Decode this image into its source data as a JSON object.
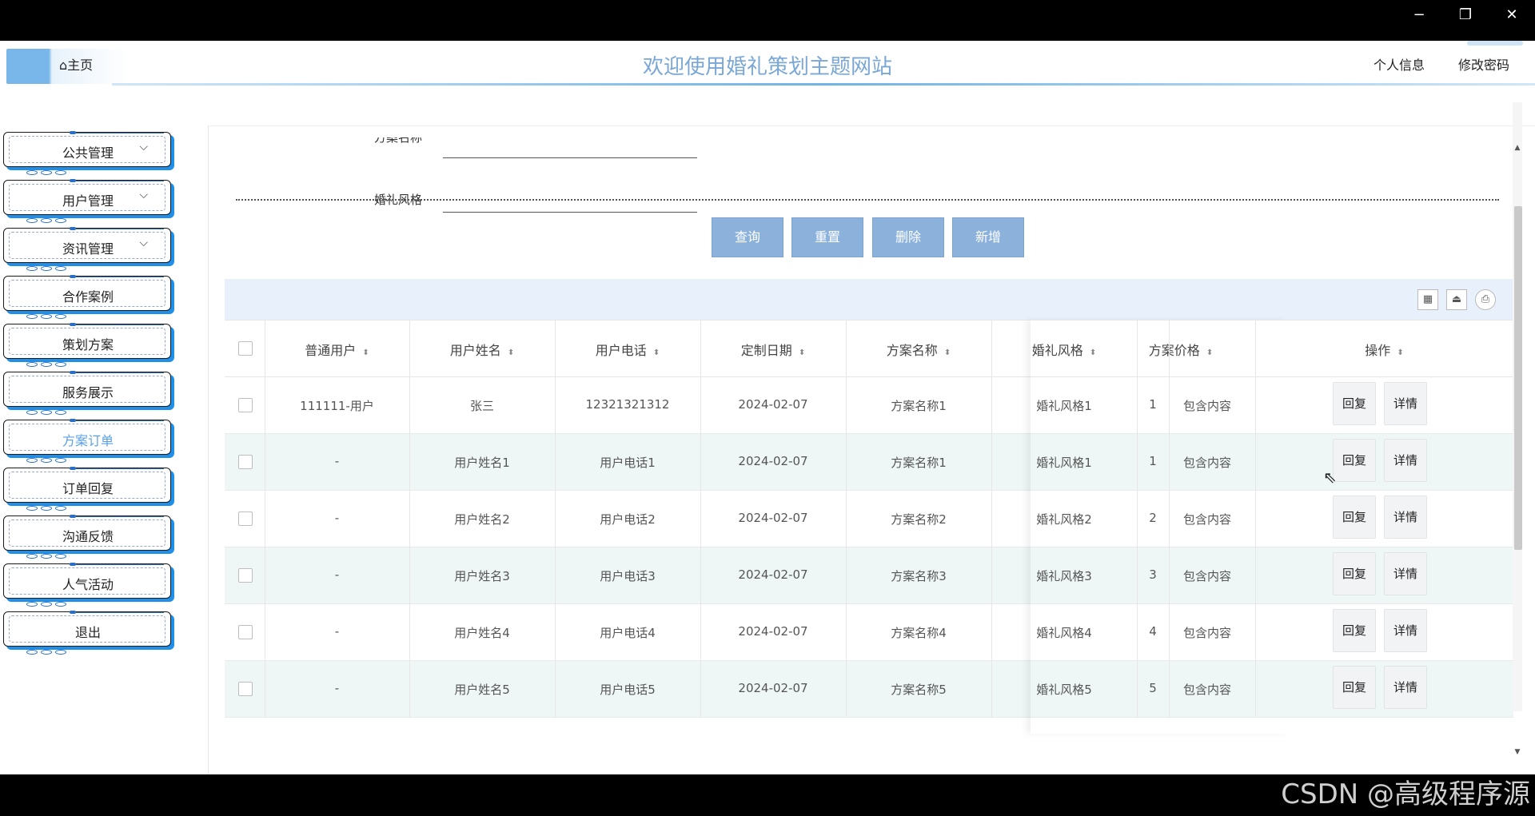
{
  "window": {
    "minimize": "−",
    "restore": "❐",
    "close": "✕"
  },
  "header": {
    "home": "⌂主页",
    "title": "欢迎使用婚礼策划主题网站",
    "profile": "个人信息",
    "change_password": "修改密码"
  },
  "sidebar": {
    "items": [
      {
        "label": "公共管理",
        "has_submenu": true
      },
      {
        "label": "用户管理",
        "has_submenu": true
      },
      {
        "label": "资讯管理",
        "has_submenu": true
      },
      {
        "label": "合作案例"
      },
      {
        "label": "策划方案"
      },
      {
        "label": "服务展示"
      },
      {
        "label": "方案订单",
        "active": true
      },
      {
        "label": "订单回复"
      },
      {
        "label": "沟通反馈"
      },
      {
        "label": "人气活动"
      },
      {
        "label": "退出"
      }
    ],
    "chevron": "⌵"
  },
  "search": {
    "field1_label": "方案名称",
    "field1_value": "",
    "field2_label": "婚礼风格",
    "field2_value": ""
  },
  "buttons": {
    "query": "查询",
    "reset": "重置",
    "delete": "删除",
    "add": "新增"
  },
  "toolbar": {
    "icons": [
      "columns-icon",
      "export-icon",
      "print-icon"
    ],
    "glyphs": [
      "▦",
      "⏏",
      "⎙"
    ]
  },
  "table": {
    "columns": [
      "普通用户",
      "用户姓名",
      "用户电话",
      "定制日期",
      "方案名称",
      "婚礼风格",
      "方案价格",
      "",
      "操作"
    ],
    "sort_glyph": "⬍",
    "rows": [
      [
        "111111-用户",
        "张三",
        "12321321312",
        "2024-02-07",
        "方案名称1",
        "婚礼风格1",
        "1",
        "包含内容"
      ],
      [
        "-",
        "用户姓名1",
        "用户电话1",
        "2024-02-07",
        "方案名称1",
        "婚礼风格1",
        "1",
        "包含内容"
      ],
      [
        "-",
        "用户姓名2",
        "用户电话2",
        "2024-02-07",
        "方案名称2",
        "婚礼风格2",
        "2",
        "包含内容"
      ],
      [
        "-",
        "用户姓名3",
        "用户电话3",
        "2024-02-07",
        "方案名称3",
        "婚礼风格3",
        "3",
        "包含内容"
      ],
      [
        "-",
        "用户姓名4",
        "用户电话4",
        "2024-02-07",
        "方案名称4",
        "婚礼风格4",
        "4",
        "包含内容"
      ],
      [
        "-",
        "用户姓名5",
        "用户电话5",
        "2024-02-07",
        "方案名称5",
        "婚礼风格5",
        "5",
        "包含内容"
      ]
    ],
    "actions": {
      "reply": "回复",
      "detail": "详情"
    }
  },
  "watermark": "CSDN @高级程序源"
}
